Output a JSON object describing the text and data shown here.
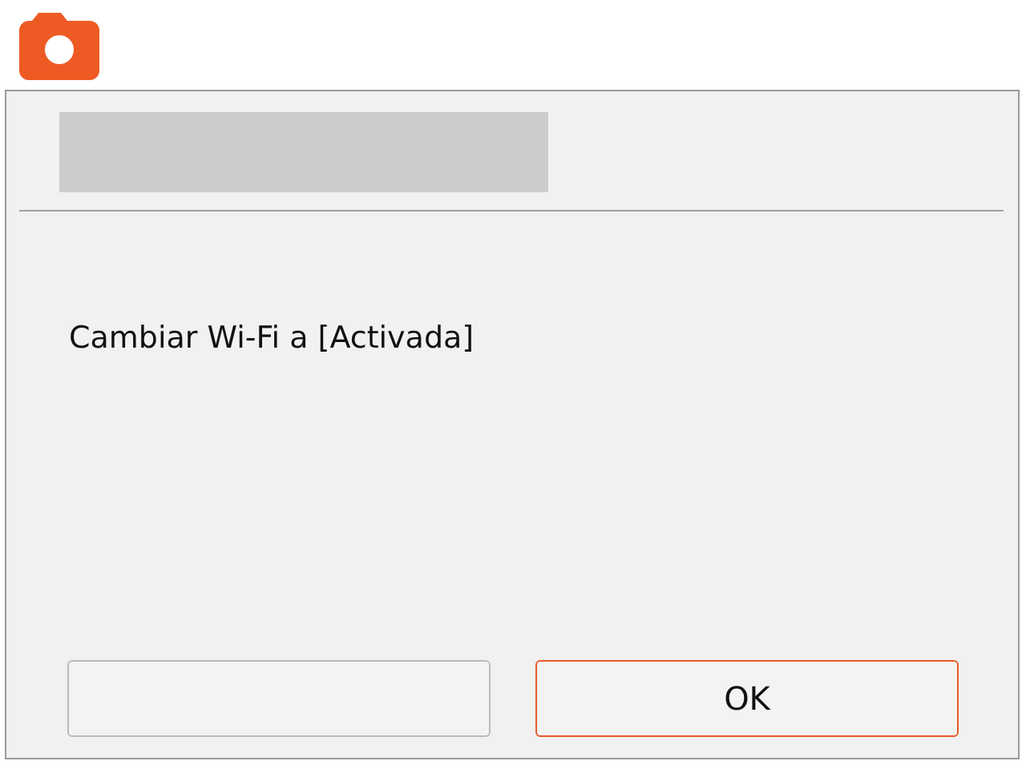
{
  "message": "Cambiar Wi-Fi a [Activada]",
  "buttons": [
    {
      "selected": false
    },
    {
      "label": "OK",
      "selected": true
    }
  ]
}
